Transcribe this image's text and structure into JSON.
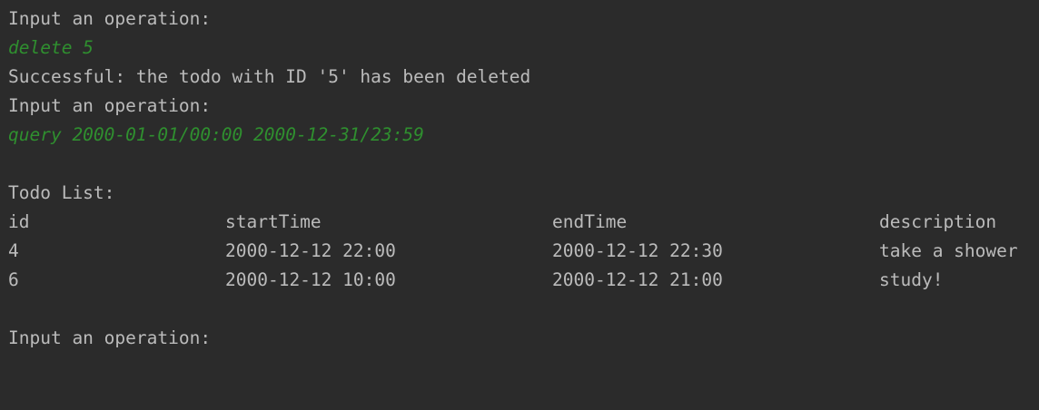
{
  "console": {
    "prompt": "Input an operation:",
    "command_1": "delete 5",
    "message_1": "Successful: the todo with ID '5' has been deleted",
    "command_2": "query 2000-01-01/00:00 2000-12-31/23:59",
    "list_title": "Todo List:",
    "table": {
      "headers": [
        "id",
        "startTime",
        "endTime",
        "description"
      ],
      "rows": [
        [
          "4",
          "2000-12-12 22:00",
          "2000-12-12 22:30",
          "take a shower"
        ],
        [
          "6",
          "2000-12-12 10:00",
          "2000-12-12 21:00",
          "study!"
        ]
      ]
    }
  },
  "colors": {
    "background": "#2b2b2b",
    "text": "#bbbbbb",
    "user_input": "#2f8f2f"
  }
}
